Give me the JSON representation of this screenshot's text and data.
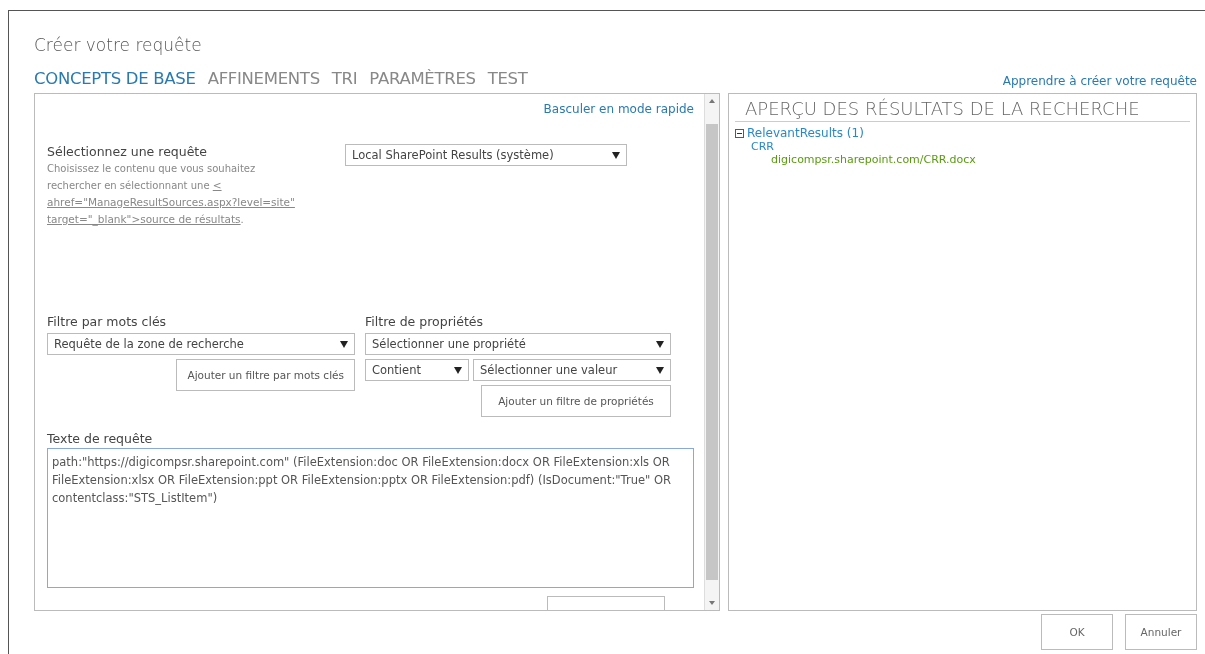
{
  "dialog": {
    "title": "Créer votre requête",
    "help_link": "Apprendre à créer votre requête"
  },
  "tabs": [
    {
      "label": "CONCEPTS DE BASE",
      "selected": true
    },
    {
      "label": "AFFINEMENTS",
      "selected": false
    },
    {
      "label": "TRI",
      "selected": false
    },
    {
      "label": "PARAMÈTRES",
      "selected": false
    },
    {
      "label": "TEST",
      "selected": false
    }
  ],
  "basics": {
    "quick_mode_link": "Basculer en mode rapide",
    "select_query": {
      "label": "Sélectionnez une requête",
      "description": "Choisissez le contenu que vous souhaitez rechercher en sélectionnant une",
      "link": "< ahref=\"ManageResultSources.aspx?level=site\" target=\"_blank\">source de résultats",
      "link_end": ".",
      "value": "Local SharePoint Results (système)"
    },
    "keyword_filter": {
      "label": "Filtre par mots clés",
      "value": "Requête de la zone de recherche",
      "button": "Ajouter un filtre par mots clés"
    },
    "property_filter": {
      "label": "Filtre de propriétés",
      "property": "Sélectionner une propriété",
      "operator": "Contient",
      "value": "Sélectionner une valeur",
      "button": "Ajouter un filtre de propriétés"
    },
    "query_text": {
      "label": "Texte de requête",
      "value": "path:\"https://digicompsr.sharepoint.com\"  (FileExtension:doc OR FileExtension:docx OR FileExtension:xls OR FileExtension:xlsx OR FileExtension:ppt OR FileExtension:pptx OR FileExtension:pdf) (IsDocument:\"True\" OR contentclass:\"STS_ListItem\")"
    }
  },
  "preview": {
    "title": "APERÇU DES RÉSULTATS DE LA RECHERCHE",
    "groups": [
      {
        "label": "RelevantResults (1)",
        "expanded": true,
        "children": [
          {
            "title": "CRR",
            "url": "digicompsr.sharepoint.com/CRR.docx"
          }
        ]
      }
    ]
  },
  "buttons": [
    "OK",
    "Annuler"
  ]
}
